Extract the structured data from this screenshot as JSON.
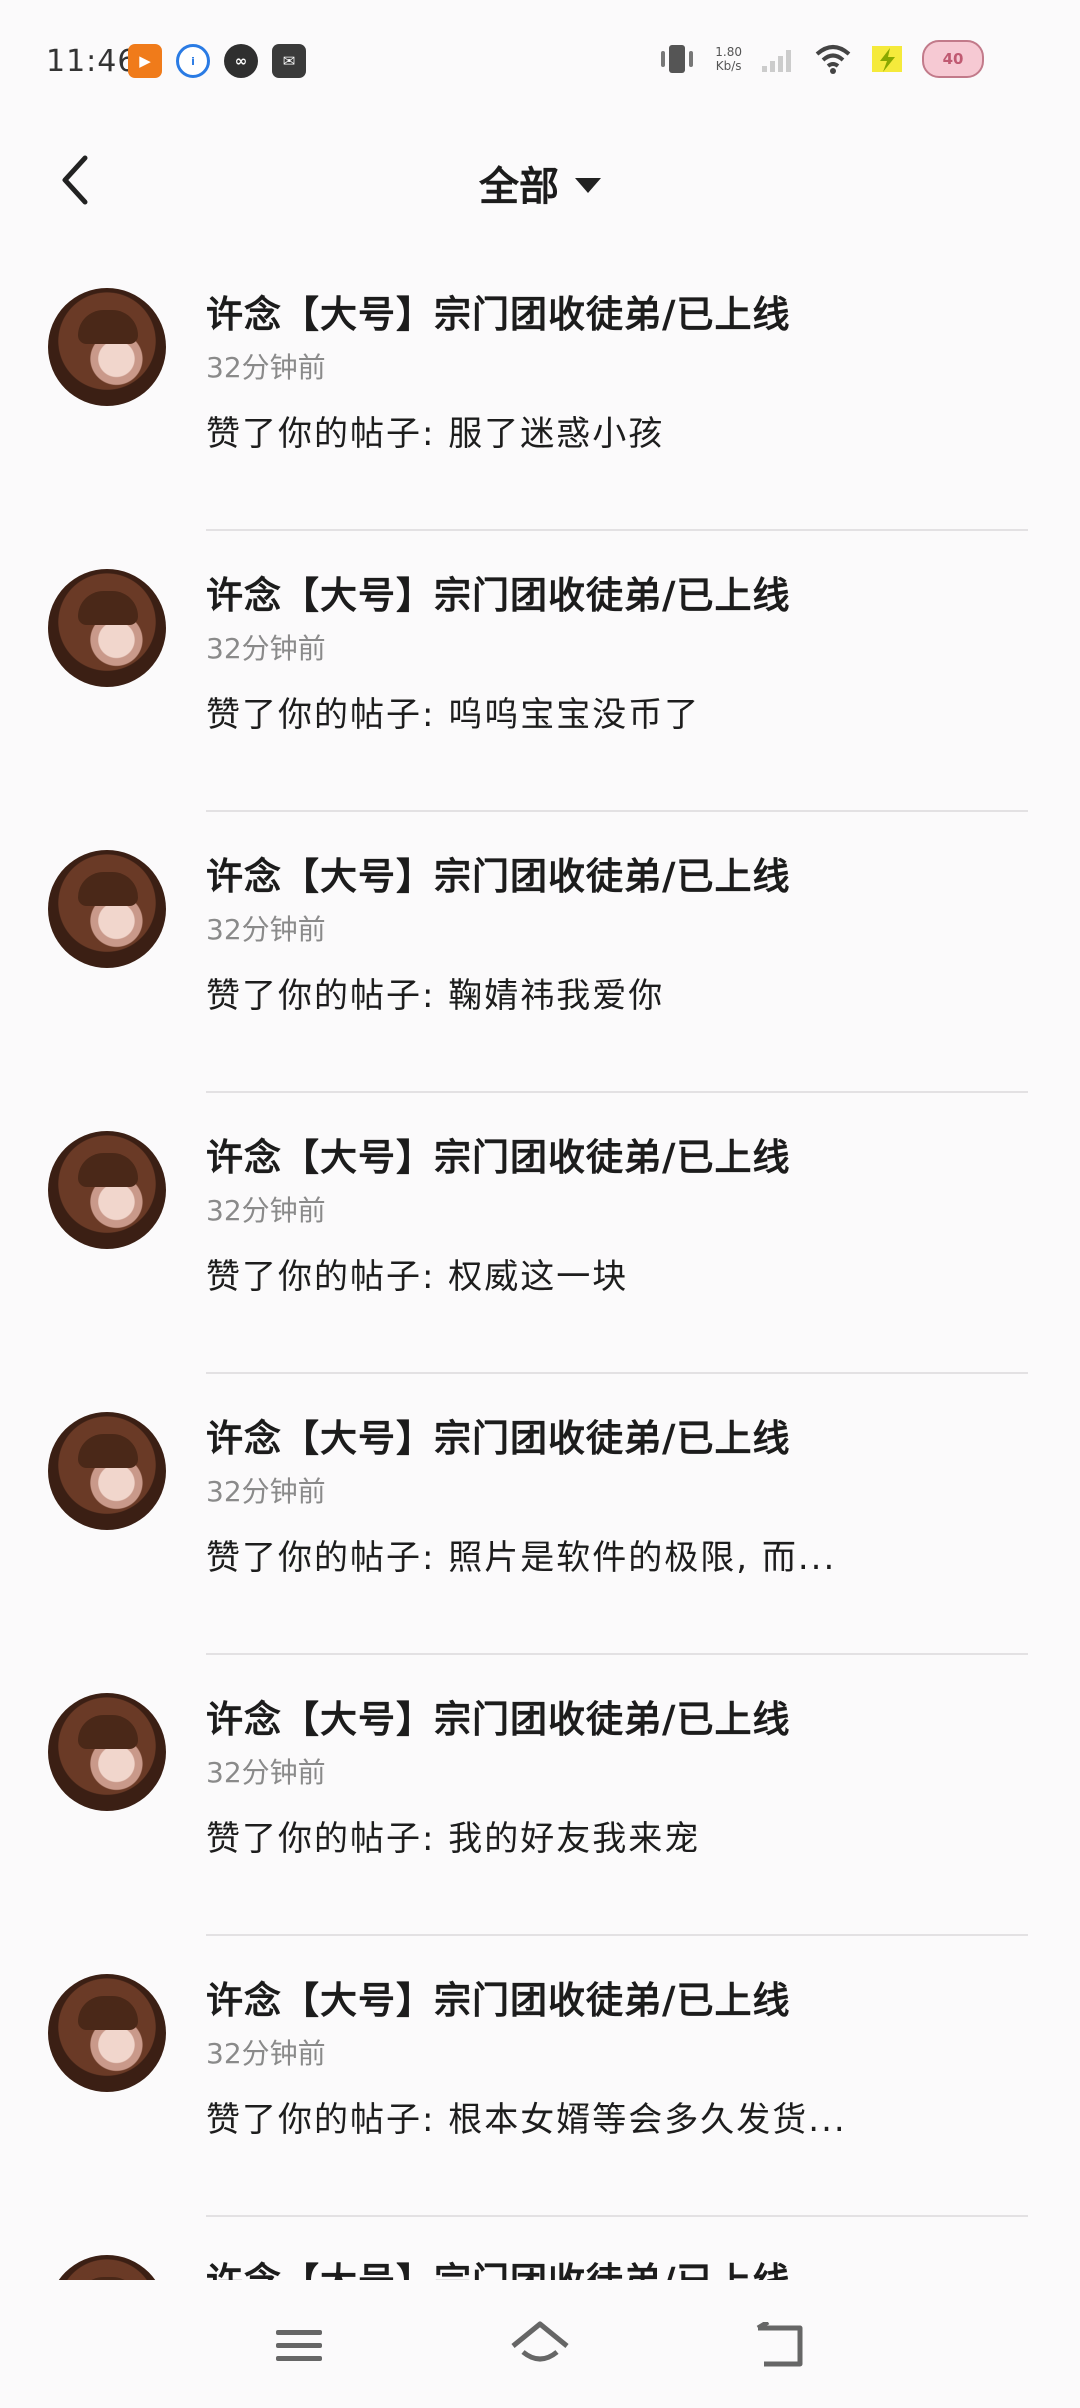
{
  "status_bar": {
    "time": "11:46",
    "net_speed_value": "1.80",
    "net_speed_unit": "Kb/s",
    "battery": "40"
  },
  "header": {
    "title": "全部"
  },
  "notifications": [
    {
      "name": "许念【大号】宗门团收徒弟/已上线",
      "time": "32分钟前",
      "message": "赞了你的帖子: 服了迷惑小孩"
    },
    {
      "name": "许念【大号】宗门团收徒弟/已上线",
      "time": "32分钟前",
      "message": "赞了你的帖子: 呜呜宝宝没币了"
    },
    {
      "name": "许念【大号】宗门团收徒弟/已上线",
      "time": "32分钟前",
      "message": "赞了你的帖子: 鞠婧祎我爱你"
    },
    {
      "name": "许念【大号】宗门团收徒弟/已上线",
      "time": "32分钟前",
      "message": "赞了你的帖子: 权威这一块"
    },
    {
      "name": "许念【大号】宗门团收徒弟/已上线",
      "time": "32分钟前",
      "message": "赞了你的帖子: 照片是软件的极限, 而..."
    },
    {
      "name": "许念【大号】宗门团收徒弟/已上线",
      "time": "32分钟前",
      "message": "赞了你的帖子: 我的好友我来宠"
    },
    {
      "name": "许念【大号】宗门团收徒弟/已上线",
      "time": "32分钟前",
      "message": "赞了你的帖子: 根本女婿等会多久发货..."
    },
    {
      "name": "许念【大号】宗门团收徒弟/已上线",
      "time": "",
      "message": ""
    }
  ]
}
